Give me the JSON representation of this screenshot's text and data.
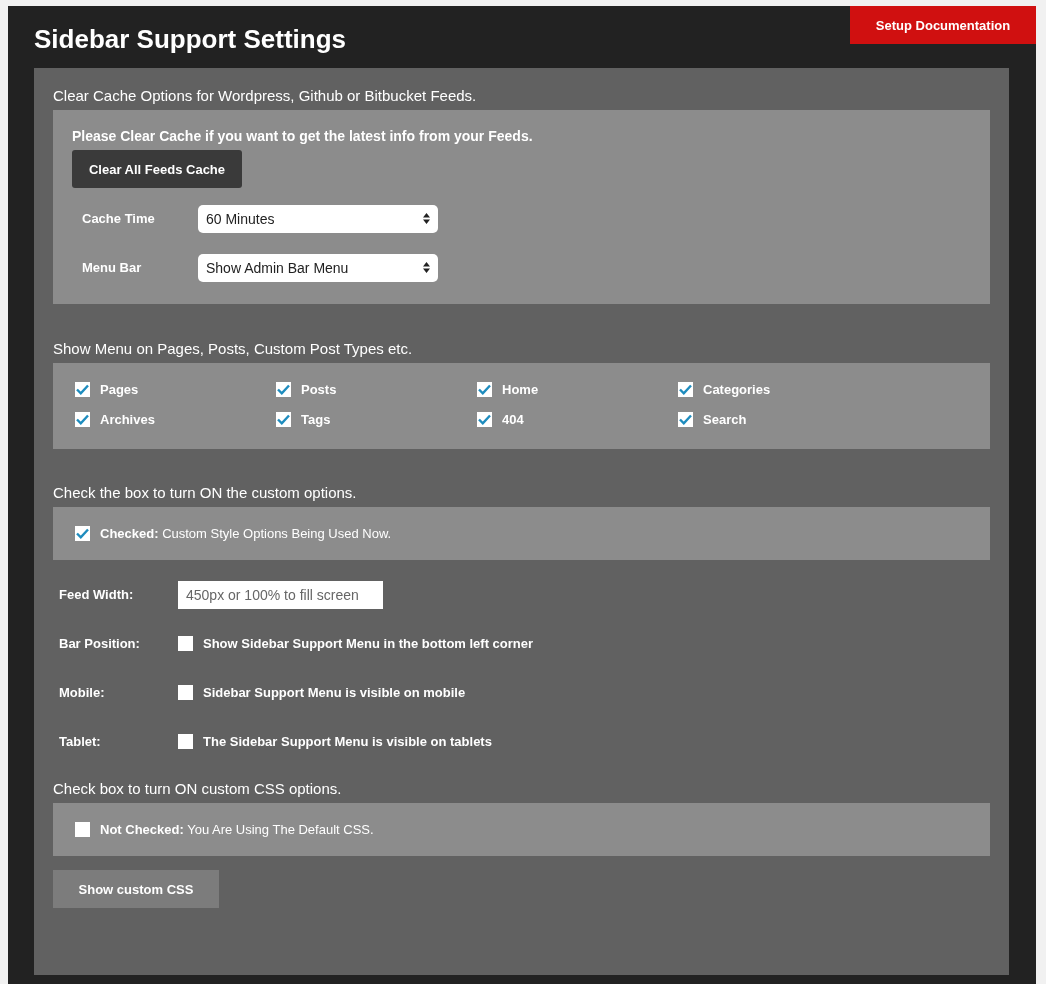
{
  "title": "Sidebar Support Settings",
  "doc_button": "Setup Documentation",
  "cache": {
    "heading": "Clear Cache Options for Wordpress, Github or Bitbucket Feeds.",
    "note": "Please Clear Cache if you want to get the latest info from your Feeds.",
    "button": "Clear All Feeds Cache",
    "selects": [
      {
        "label": "Cache Time",
        "value": "60 Minutes"
      },
      {
        "label": "Menu Bar",
        "value": "Show Admin Bar Menu"
      }
    ]
  },
  "show_menu": {
    "heading": "Show Menu on Pages, Posts, Custom Post Types etc.",
    "items": [
      {
        "label": "Pages",
        "checked": true
      },
      {
        "label": "Posts",
        "checked": true
      },
      {
        "label": "Home",
        "checked": true
      },
      {
        "label": "Categories",
        "checked": true
      },
      {
        "label": "Archives",
        "checked": true
      },
      {
        "label": "Tags",
        "checked": true
      },
      {
        "label": "404",
        "checked": true
      },
      {
        "label": "Search",
        "checked": true
      }
    ]
  },
  "custom": {
    "heading": "Check the box to turn ON the custom options.",
    "toggle": {
      "text": "**Checked:** Custom Style Options Being Used Now.",
      "checked": true
    },
    "fields": [
      {
        "kind": "input",
        "label": "Feed Width:",
        "placeholder": "450px or 100% to fill screen"
      },
      {
        "kind": "checkbox",
        "label": "Bar Position:",
        "text": "Show Sidebar Support Menu in the bottom left corner",
        "checked": false
      },
      {
        "kind": "checkbox",
        "label": "Mobile:",
        "text": "Sidebar Support Menu is visible on mobile",
        "checked": false
      },
      {
        "kind": "checkbox",
        "label": "Tablet:",
        "text": "The Sidebar Support Menu is visible on tablets",
        "checked": false
      }
    ]
  },
  "css": {
    "heading": "Check box to turn ON custom CSS options.",
    "toggle": {
      "text": "**Not Checked:** You Are Using The Default CSS.",
      "checked": false
    },
    "button": "Show custom CSS"
  }
}
